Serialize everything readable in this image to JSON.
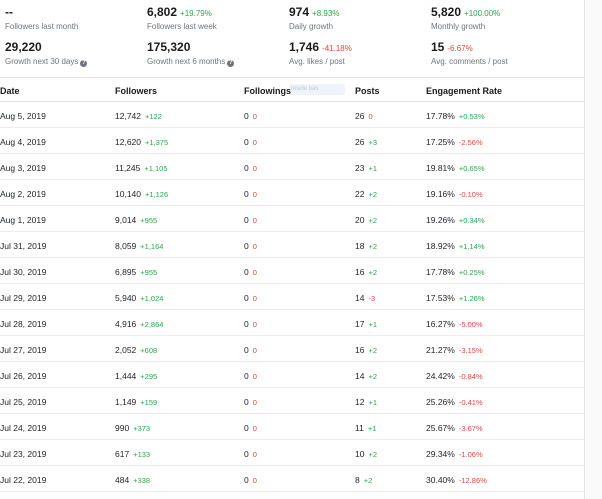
{
  "stats_row1": [
    {
      "value": "--",
      "delta": "",
      "delta_class": "",
      "label": "Followers last month"
    },
    {
      "value": "6,802",
      "delta": "+19.79%",
      "delta_class": "pos",
      "label": "Followers last week"
    },
    {
      "value": "974",
      "delta": "+8.93%",
      "delta_class": "pos",
      "label": "Daily growth"
    },
    {
      "value": "5,820",
      "delta": "+100.00%",
      "delta_class": "pos",
      "label": "Monthly growth"
    }
  ],
  "stats_row2": [
    {
      "value": "29,220",
      "delta": "",
      "delta_class": "",
      "label": "Growth next 30 days",
      "info": "?"
    },
    {
      "value": "175,320",
      "delta": "",
      "delta_class": "",
      "label": "Growth next 6 months",
      "info": "?"
    },
    {
      "value": "1,746",
      "delta": "-41.18%",
      "delta_class": "neg",
      "label": "Avg. likes / post"
    },
    {
      "value": "15",
      "delta": "-6.67%",
      "delta_class": "neg",
      "label": "Avg. comments / post"
    }
  ],
  "table": {
    "headers": {
      "date": "Date",
      "followers": "Followers",
      "followings": "Followings",
      "posts": "Posts",
      "engagement": "Engagement Rate"
    },
    "tooltip_hint": "Inside bas",
    "rows": [
      {
        "date": "Aug 5, 2019",
        "followers": "12,742",
        "followers_delta": "+122",
        "fd": "pos",
        "followings": "0",
        "followings_delta": "0",
        "fwd": "neg",
        "posts": "26",
        "posts_delta": "0",
        "pd": "neg",
        "eng": "17.78%",
        "eng_delta": "+0.53%",
        "ed": "pos"
      },
      {
        "date": "Aug 4, 2019",
        "followers": "12,620",
        "followers_delta": "+1,375",
        "fd": "pos",
        "followings": "0",
        "followings_delta": "0",
        "fwd": "neg",
        "posts": "26",
        "posts_delta": "+3",
        "pd": "pos",
        "eng": "17.25%",
        "eng_delta": "-2.56%",
        "ed": "neg"
      },
      {
        "date": "Aug 3, 2019",
        "followers": "11,245",
        "followers_delta": "+1,105",
        "fd": "pos",
        "followings": "0",
        "followings_delta": "0",
        "fwd": "neg",
        "posts": "23",
        "posts_delta": "+1",
        "pd": "pos",
        "eng": "19.81%",
        "eng_delta": "+0.65%",
        "ed": "pos"
      },
      {
        "date": "Aug 2, 2019",
        "followers": "10,140",
        "followers_delta": "+1,126",
        "fd": "pos",
        "followings": "0",
        "followings_delta": "0",
        "fwd": "neg",
        "posts": "22",
        "posts_delta": "+2",
        "pd": "pos",
        "eng": "19.16%",
        "eng_delta": "-0.10%",
        "ed": "neg"
      },
      {
        "date": "Aug 1, 2019",
        "followers": "9,014",
        "followers_delta": "+955",
        "fd": "pos",
        "followings": "0",
        "followings_delta": "0",
        "fwd": "neg",
        "posts": "20",
        "posts_delta": "+2",
        "pd": "pos",
        "eng": "19.26%",
        "eng_delta": "+0.34%",
        "ed": "pos"
      },
      {
        "date": "Jul 31, 2019",
        "followers": "8,059",
        "followers_delta": "+1,164",
        "fd": "pos",
        "followings": "0",
        "followings_delta": "0",
        "fwd": "neg",
        "posts": "18",
        "posts_delta": "+2",
        "pd": "pos",
        "eng": "18.92%",
        "eng_delta": "+1.14%",
        "ed": "pos"
      },
      {
        "date": "Jul 30, 2019",
        "followers": "6,895",
        "followers_delta": "+955",
        "fd": "pos",
        "followings": "0",
        "followings_delta": "0",
        "fwd": "neg",
        "posts": "16",
        "posts_delta": "+2",
        "pd": "pos",
        "eng": "17.78%",
        "eng_delta": "+0.25%",
        "ed": "pos"
      },
      {
        "date": "Jul 29, 2019",
        "followers": "5,940",
        "followers_delta": "+1,024",
        "fd": "pos",
        "followings": "0",
        "followings_delta": "0",
        "fwd": "neg",
        "posts": "14",
        "posts_delta": "-3",
        "pd": "neg",
        "eng": "17.53%",
        "eng_delta": "+1.26%",
        "ed": "pos"
      },
      {
        "date": "Jul 28, 2019",
        "followers": "4,916",
        "followers_delta": "+2,864",
        "fd": "pos",
        "followings": "0",
        "followings_delta": "0",
        "fwd": "neg",
        "posts": "17",
        "posts_delta": "+1",
        "pd": "pos",
        "eng": "16.27%",
        "eng_delta": "-5.00%",
        "ed": "neg"
      },
      {
        "date": "Jul 27, 2019",
        "followers": "2,052",
        "followers_delta": "+608",
        "fd": "pos",
        "followings": "0",
        "followings_delta": "0",
        "fwd": "neg",
        "posts": "16",
        "posts_delta": "+2",
        "pd": "pos",
        "eng": "21.27%",
        "eng_delta": "-3.15%",
        "ed": "neg"
      },
      {
        "date": "Jul 26, 2019",
        "followers": "1,444",
        "followers_delta": "+295",
        "fd": "pos",
        "followings": "0",
        "followings_delta": "0",
        "fwd": "neg",
        "posts": "14",
        "posts_delta": "+2",
        "pd": "pos",
        "eng": "24.42%",
        "eng_delta": "-0.84%",
        "ed": "neg"
      },
      {
        "date": "Jul 25, 2019",
        "followers": "1,149",
        "followers_delta": "+159",
        "fd": "pos",
        "followings": "0",
        "followings_delta": "0",
        "fwd": "neg",
        "posts": "12",
        "posts_delta": "+1",
        "pd": "pos",
        "eng": "25.26%",
        "eng_delta": "-0.41%",
        "ed": "neg"
      },
      {
        "date": "Jul 24, 2019",
        "followers": "990",
        "followers_delta": "+373",
        "fd": "pos",
        "followings": "0",
        "followings_delta": "0",
        "fwd": "neg",
        "posts": "11",
        "posts_delta": "+1",
        "pd": "pos",
        "eng": "25.67%",
        "eng_delta": "-3.67%",
        "ed": "neg"
      },
      {
        "date": "Jul 23, 2019",
        "followers": "617",
        "followers_delta": "+133",
        "fd": "pos",
        "followings": "0",
        "followings_delta": "0",
        "fwd": "neg",
        "posts": "10",
        "posts_delta": "+2",
        "pd": "pos",
        "eng": "29.34%",
        "eng_delta": "-1.06%",
        "ed": "neg"
      },
      {
        "date": "Jul 22, 2019",
        "followers": "484",
        "followers_delta": "+338",
        "fd": "pos",
        "followings": "0",
        "followings_delta": "0",
        "fwd": "neg",
        "posts": "8",
        "posts_delta": "+2",
        "pd": "pos",
        "eng": "30.40%",
        "eng_delta": "-12.86%",
        "ed": "neg"
      }
    ]
  }
}
